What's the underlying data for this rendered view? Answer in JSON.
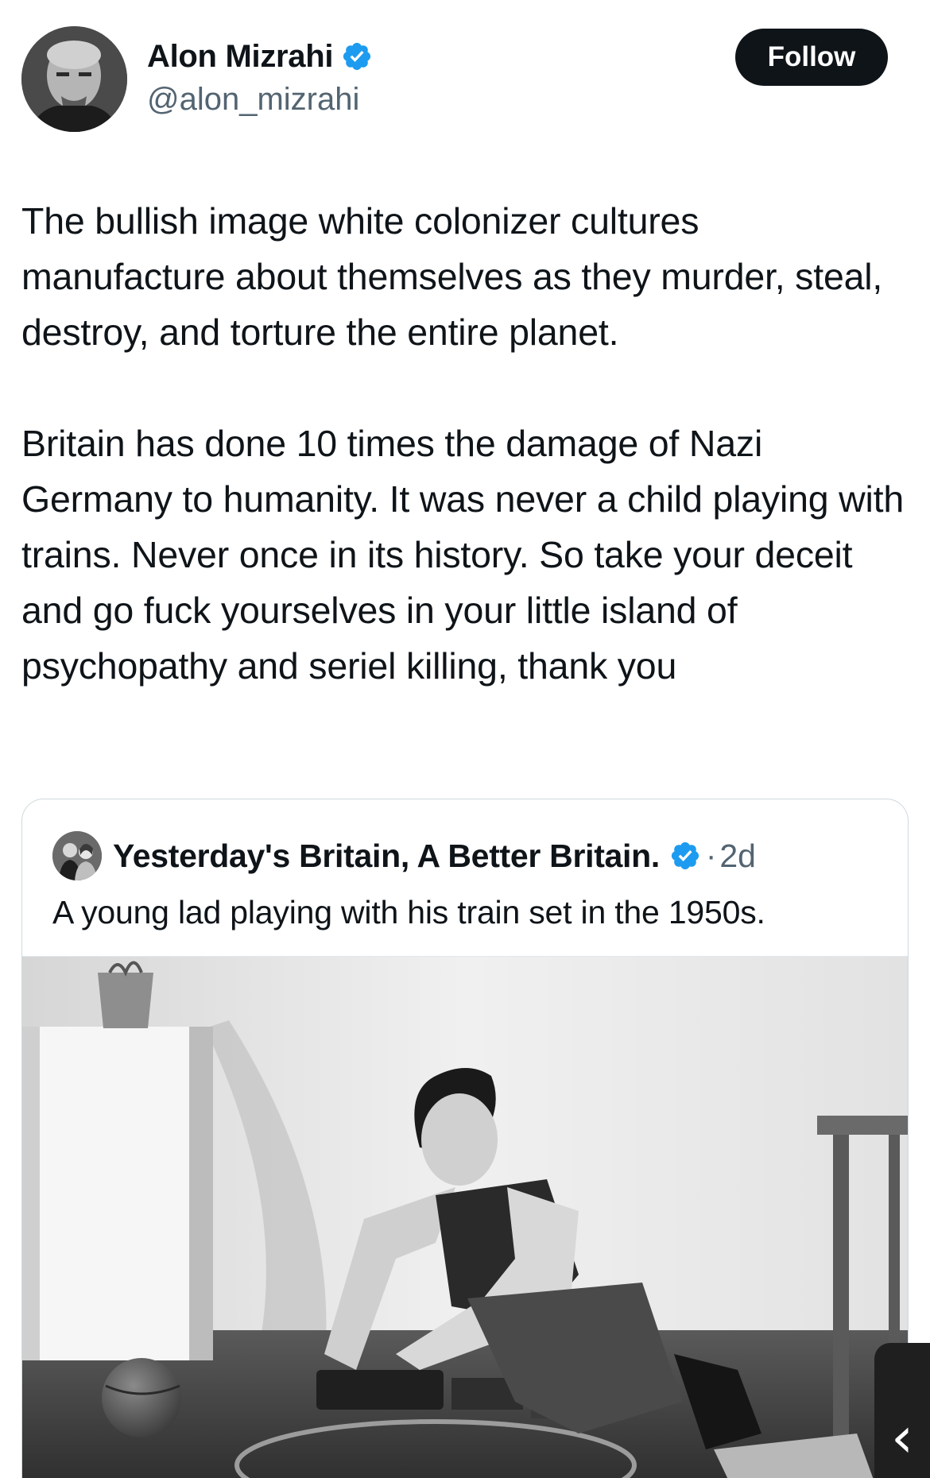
{
  "tweet": {
    "author": {
      "display_name": "Alon Mizrahi",
      "handle": "@alon_mizrahi",
      "verified": true,
      "avatar_icon": "user-avatar"
    },
    "follow_label": "Follow",
    "text_paragraphs": [
      "The bullish image white colonizer cultures manufacture about themselves as they murder, steal, destroy, and torture the entire planet.",
      "Britain has done 10 times the damage of Nazi Germany to humanity. It was never a child playing with trains. Never once in its history. So take your deceit and go fuck yourselves in your little island of psychopathy and seriel killing, thank you"
    ]
  },
  "quote": {
    "author": {
      "display_name": "Yesterday's Britain, A Better Britain.",
      "verified": true,
      "avatar_icon": "couple-photo-avatar"
    },
    "separator": "·",
    "time": "2d",
    "text": "A young lad playing with his train set in the 1950s.",
    "media": {
      "type": "black-and-white-photo",
      "icon": "boy-with-train-set-photo"
    }
  },
  "overlay": {
    "scroll_tab_glyph": "‹"
  },
  "colors": {
    "text_primary": "#0f1419",
    "text_secondary": "#536471",
    "verified_blue": "#1d9bf0",
    "follow_bg": "#0f1419",
    "card_border": "#cfd9de"
  }
}
